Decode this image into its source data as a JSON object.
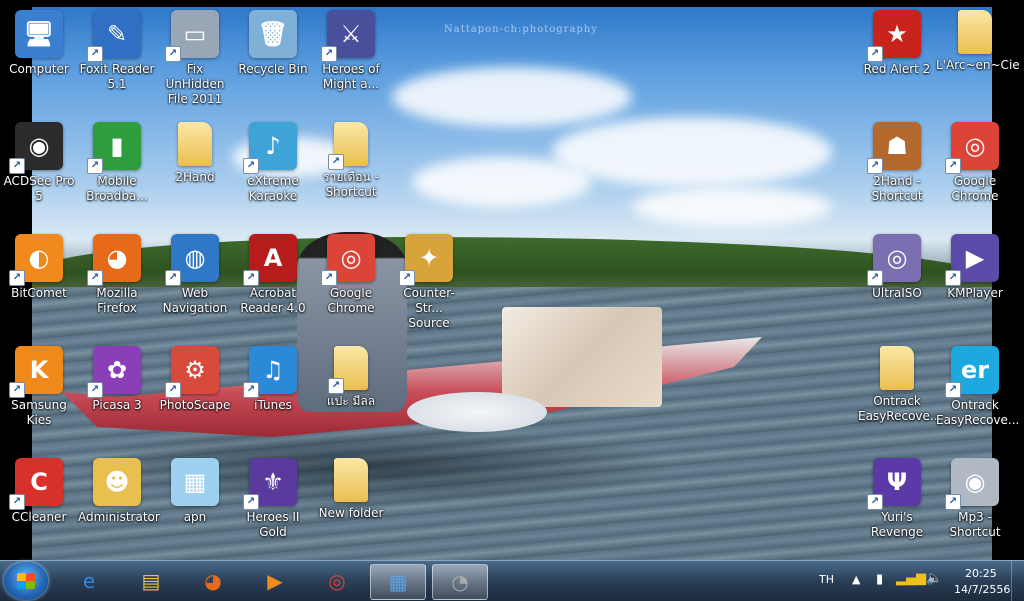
{
  "wallpaper": {
    "watermark": "Nattapon-ch:photography"
  },
  "icons": [
    {
      "label": "Computer",
      "glyph": "🖥",
      "color": "#3a7fd0",
      "shortcut": false
    },
    {
      "label": "Foxit Reader\n5.1",
      "glyph": "✎",
      "color": "#2f6fc4",
      "shortcut": true
    },
    {
      "label": "Fix UnHidden\nFile 2011",
      "glyph": "▭",
      "color": "#98a6b5",
      "shortcut": true
    },
    {
      "label": "Recycle Bin",
      "glyph": "🗑",
      "color": "#7fb0d8",
      "shortcut": false
    },
    {
      "label": "Heroes of\nMight a...",
      "glyph": "⚔",
      "color": "#4a4f9c",
      "shortcut": true
    },
    {
      "label": "Red Alert 2",
      "glyph": "★",
      "color": "#c8231d",
      "shortcut": true
    },
    {
      "label": "L'Arc~en~Cie",
      "glyph": "",
      "color": "#e9bf50",
      "shortcut": false
    },
    {
      "label": "ACDSee Pro 5",
      "glyph": "◉",
      "color": "#2b2b2b",
      "shortcut": true
    },
    {
      "label": "Mobile\nBroadba...",
      "glyph": "▮",
      "color": "#2e9d3e",
      "shortcut": true
    },
    {
      "label": "2Hand",
      "glyph": "",
      "color": "#e9bf50",
      "shortcut": false
    },
    {
      "label": "eXtreme\nKaraoke",
      "glyph": "♪",
      "color": "#3ea4d8",
      "shortcut": true
    },
    {
      "label": "รายเดือน -\nShortcut",
      "glyph": "",
      "color": "#e9bf50",
      "shortcut": true
    },
    {
      "label": "2Hand -\nShortcut",
      "glyph": "☗",
      "color": "#b3692d",
      "shortcut": true
    },
    {
      "label": "Google\nChrome",
      "glyph": "◎",
      "color": "#db4437",
      "shortcut": true
    },
    {
      "label": "BitComet",
      "glyph": "◐",
      "color": "#f08a1d",
      "shortcut": true
    },
    {
      "label": "Mozilla\nFirefox",
      "glyph": "◕",
      "color": "#e66a1a",
      "shortcut": true
    },
    {
      "label": "Web\nNavigation",
      "glyph": "◍",
      "color": "#2f78c8",
      "shortcut": true
    },
    {
      "label": "Acrobat\nReader 4.0",
      "glyph": "A",
      "color": "#b61c1c",
      "shortcut": true
    },
    {
      "label": "Google\nChrome",
      "glyph": "◎",
      "color": "#db4437",
      "shortcut": true
    },
    {
      "label": "Counter-Str...\nSource",
      "glyph": "✦",
      "color": "#d6a43a",
      "shortcut": true
    },
    {
      "label": "UltraISO",
      "glyph": "◎",
      "color": "#7b6fb2",
      "shortcut": true
    },
    {
      "label": "KMPlayer",
      "glyph": "▶",
      "color": "#5b4aa8",
      "shortcut": true
    },
    {
      "label": "Samsung Kies",
      "glyph": "K",
      "color": "#ef8a1a",
      "shortcut": true
    },
    {
      "label": "Picasa 3",
      "glyph": "✿",
      "color": "#8a3fb8",
      "shortcut": true
    },
    {
      "label": "PhotoScape",
      "glyph": "⚙",
      "color": "#d84a3a",
      "shortcut": true
    },
    {
      "label": "iTunes",
      "glyph": "♫",
      "color": "#2b8ad8",
      "shortcut": true
    },
    {
      "label": "แปะ มีลล",
      "glyph": "",
      "color": "#e9bf50",
      "shortcut": true
    },
    {
      "label": "Ontrack\nEasyRecove...",
      "glyph": "",
      "color": "#e9bf50",
      "shortcut": false
    },
    {
      "label": "Ontrack\nEasyRecove...",
      "glyph": "er",
      "color": "#1da8e0",
      "shortcut": true
    },
    {
      "label": "CCleaner",
      "glyph": "C",
      "color": "#d8302a",
      "shortcut": true
    },
    {
      "label": "Administrator",
      "glyph": "☻",
      "color": "#e9bf50",
      "shortcut": false
    },
    {
      "label": "apn",
      "glyph": "▦",
      "color": "#9ed0f0",
      "shortcut": false
    },
    {
      "label": "Heroes II Gold",
      "glyph": "⚜",
      "color": "#5a3a9c",
      "shortcut": true
    },
    {
      "label": "New folder",
      "glyph": "",
      "color": "#e9bf50",
      "shortcut": false
    },
    {
      "label": "Yuri's\nRevenge",
      "glyph": "Ψ",
      "color": "#5b3aa8",
      "shortcut": true
    },
    {
      "label": "Mp3 -\nShortcut",
      "glyph": "◉",
      "color": "#b0b8c4",
      "shortcut": true
    }
  ],
  "taskbar": {
    "items": [
      {
        "name": "taskbar-ie",
        "glyph": "e",
        "color": "#2a8ae0"
      },
      {
        "name": "taskbar-explorer",
        "glyph": "▤",
        "color": "#e9bf50"
      },
      {
        "name": "taskbar-firefox",
        "glyph": "◕",
        "color": "#e66a1a"
      },
      {
        "name": "taskbar-media",
        "glyph": "▶",
        "color": "#f08a1d"
      },
      {
        "name": "taskbar-chrome",
        "glyph": "◎",
        "color": "#db4437"
      },
      {
        "name": "taskbar-control",
        "glyph": "▦",
        "color": "#5aa0e0"
      },
      {
        "name": "taskbar-app",
        "glyph": "◔",
        "color": "#aaaaaa"
      }
    ],
    "language": "TH",
    "time": "20:25",
    "date": "14/7/2556"
  }
}
